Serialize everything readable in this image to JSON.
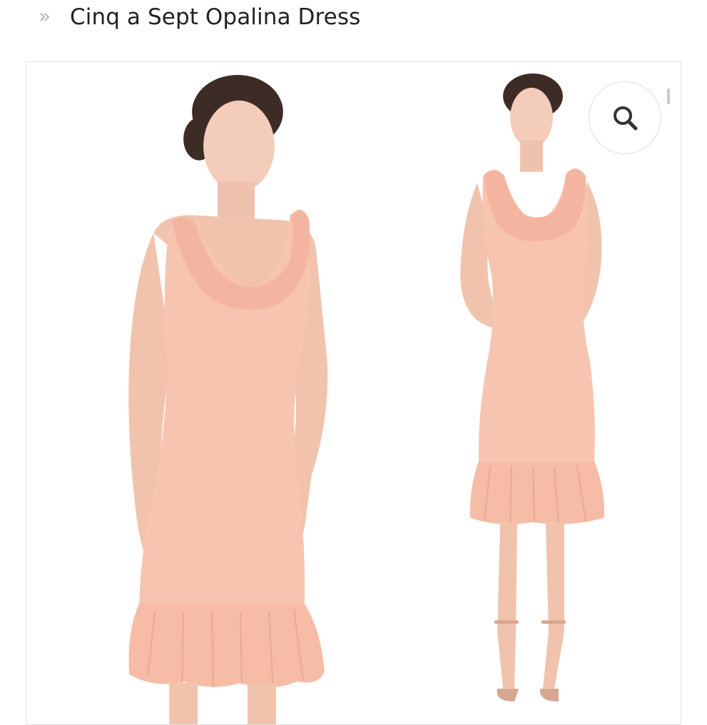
{
  "breadcrumb": {
    "separator": "»",
    "title": "Cinq a Sept Opalina Dress"
  },
  "gallery": {
    "images": [
      {
        "icon": "model-front-three-quarter-photo",
        "dress_color": "#f7c4b0"
      },
      {
        "icon": "model-full-length-photo",
        "dress_color": "#f7c4b0"
      }
    ],
    "zoom_icon": "search-icon"
  },
  "colors": {
    "dress": "#f7c4b0",
    "skin": "#f3cdb9",
    "hair": "#3d2c25",
    "border": "#e3e3e3",
    "title_text": "#222222",
    "separator": "#b3b3b3"
  }
}
